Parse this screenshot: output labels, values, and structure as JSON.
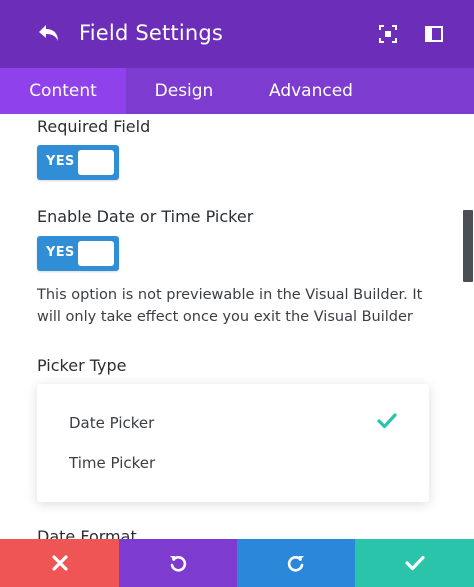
{
  "header": {
    "title": "Field Settings",
    "back_icon": "undo-arrow-icon",
    "expand_icon": "expand-icon",
    "layout_icon": "sidebar-layout-icon"
  },
  "tabs": [
    {
      "label": "Content",
      "active": true
    },
    {
      "label": "Design",
      "active": false
    },
    {
      "label": "Advanced",
      "active": false
    }
  ],
  "fields": {
    "required_field": {
      "label": "Required Field",
      "toggle": "YES"
    },
    "date_time_picker": {
      "label": "Enable Date or Time Picker",
      "toggle": "YES"
    },
    "help_text": "This option is not previewable in the Visual Builder. It will only take effect once you exit the Visual Builder",
    "picker_type": {
      "label": "Picker Type",
      "options": [
        "Date Picker",
        "Time Picker"
      ],
      "selected": "Date Picker"
    },
    "date_format": {
      "label": "Date Format"
    }
  },
  "footer": {
    "discard_icon": "close-icon",
    "undo_icon": "undo-icon",
    "redo_icon": "redo-icon",
    "save_icon": "check-icon"
  },
  "colors": {
    "header": "#6c2eb9",
    "tabs": "#7d3bcf",
    "active_tab": "#8f42ec",
    "toggle": "#2f8ed6",
    "check": "#29c4a9",
    "discard": "#ef5555",
    "undo": "#7d3bcf",
    "redo": "#2b87da",
    "save": "#29c4a9"
  }
}
